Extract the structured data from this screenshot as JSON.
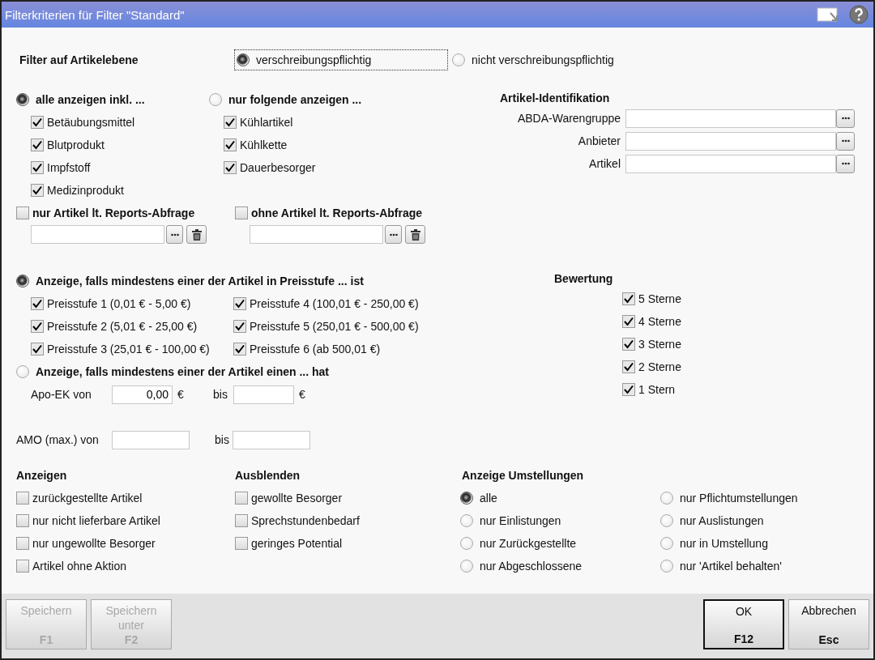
{
  "window": {
    "title": "Filterkriterien für Filter \"Standard\""
  },
  "article_level": {
    "label": "Filter auf Artikelebene",
    "options": [
      {
        "label": "verschreibungspflichtig",
        "selected": true,
        "focused": true
      },
      {
        "label": "nicht verschreibungspflichtig",
        "selected": false,
        "focused": false
      }
    ]
  },
  "display_modes": [
    {
      "label": "alle anzeigen inkl. ...",
      "selected": true,
      "items": [
        {
          "label": "Betäubungsmittel",
          "checked": true
        },
        {
          "label": "Blutprodukt",
          "checked": true
        },
        {
          "label": "Impfstoff",
          "checked": true
        },
        {
          "label": "Medizinprodukt",
          "checked": true
        }
      ]
    },
    {
      "label": "nur folgende anzeigen ...",
      "selected": false,
      "items": [
        {
          "label": "Kühlartikel",
          "checked": true
        },
        {
          "label": "Kühlkette",
          "checked": true
        },
        {
          "label": "Dauerbesorger",
          "checked": true
        }
      ]
    }
  ],
  "reports": [
    {
      "label": "nur Artikel lt. Reports-Abfrage",
      "checked": false
    },
    {
      "label": "ohne Artikel lt. Reports-Abfrage",
      "checked": false
    }
  ],
  "article_identification": {
    "title": "Artikel-Identifikation",
    "fields": [
      {
        "label": "ABDA-Warengruppe"
      },
      {
        "label": "Anbieter"
      },
      {
        "label": "Artikel"
      }
    ]
  },
  "price_modes": [
    {
      "label": "Anzeige, falls mindestens einer der Artikel in Preisstufe ... ist",
      "selected": true,
      "kind": "levels",
      "items": [
        {
          "label": "Preisstufe 1 (0,01 € - 5,00 €)",
          "checked": true
        },
        {
          "label": "Preisstufe 2 (5,01 € - 25,00 €)",
          "checked": true
        },
        {
          "label": "Preisstufe 3 (25,01 € - 100,00 €)",
          "checked": true
        },
        {
          "label": "Preisstufe 4 (100,01 € - 250,00 €)",
          "checked": true
        },
        {
          "label": "Preisstufe 5 (250,01 € - 500,00 €)",
          "checked": true
        },
        {
          "label": "Preisstufe 6 (ab 500,01 €)",
          "checked": true
        }
      ]
    },
    {
      "label": "Anzeige, falls mindestens einer der Artikel einen ... hat",
      "selected": false,
      "kind": "range",
      "from_label": "Apo-EK von",
      "from_value": "0,00",
      "from_unit": "€",
      "to_label": "bis",
      "to_unit": "€"
    }
  ],
  "amo": {
    "from_label": "AMO (max.) von",
    "to_label": "bis"
  },
  "rating": {
    "title": "Bewertung",
    "items": [
      {
        "label": "5 Sterne",
        "checked": true
      },
      {
        "label": "4 Sterne",
        "checked": true
      },
      {
        "label": "3 Sterne",
        "checked": true
      },
      {
        "label": "2 Sterne",
        "checked": true
      },
      {
        "label": "1 Stern",
        "checked": true
      }
    ]
  },
  "show": {
    "title": "Anzeigen",
    "items": [
      {
        "label": "zurückgestellte Artikel",
        "checked": false
      },
      {
        "label": "nur nicht lieferbare Artikel",
        "checked": false
      },
      {
        "label": "nur ungewollte Besorger",
        "checked": false
      },
      {
        "label": "Artikel ohne Aktion",
        "checked": false
      }
    ]
  },
  "hide": {
    "title": "Ausblenden",
    "items": [
      {
        "label": "gewollte Besorger",
        "checked": false
      },
      {
        "label": "Sprechstundenbedarf",
        "checked": false
      },
      {
        "label": "geringes Potential",
        "checked": false
      }
    ]
  },
  "changes": {
    "title": "Anzeige Umstellungen",
    "options": [
      {
        "label": "alle",
        "selected": true
      },
      {
        "label": "nur Einlistungen",
        "selected": false
      },
      {
        "label": "nur Zurückgestellte",
        "selected": false
      },
      {
        "label": "nur Abgeschlossene",
        "selected": false
      },
      {
        "label": "nur Pflichtumstellungen",
        "selected": false
      },
      {
        "label": "nur Auslistungen",
        "selected": false
      },
      {
        "label": "nur in Umstellung",
        "selected": false
      },
      {
        "label": "nur 'Artikel behalten'",
        "selected": false
      }
    ]
  },
  "left_buttons": [
    {
      "label": "Speichern",
      "key": "F1",
      "disabled": true,
      "default": false
    },
    {
      "label": "Speichern unter",
      "key": "F2",
      "disabled": true,
      "default": false
    }
  ],
  "right_buttons": [
    {
      "label": "OK",
      "key": "F12",
      "disabled": false,
      "default": true
    },
    {
      "label": "Abbrechen",
      "key": "Esc",
      "disabled": false,
      "default": false
    }
  ]
}
